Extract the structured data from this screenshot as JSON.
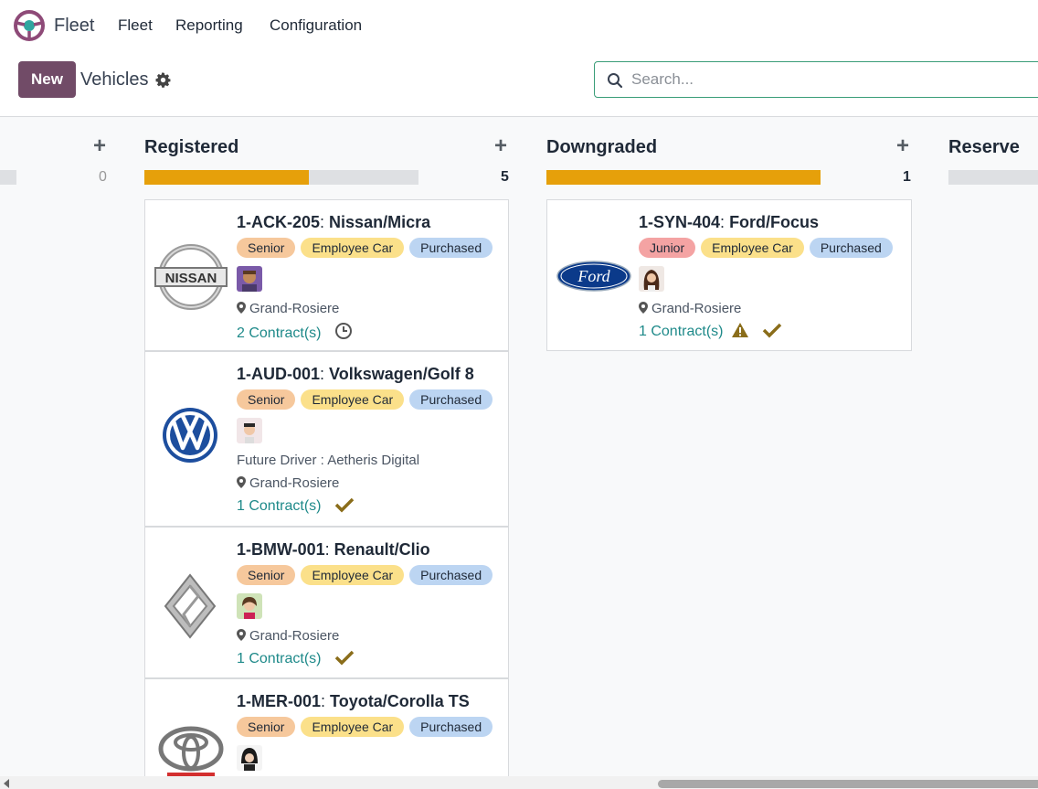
{
  "navbar": {
    "app_name": "Fleet",
    "menus": [
      "Fleet",
      "Reporting",
      "Configuration"
    ]
  },
  "control_panel": {
    "new_label": "New",
    "breadcrumb": "Vehicles",
    "search_placeholder": "Search..."
  },
  "columns": [
    {
      "title": "",
      "count": "0",
      "progress": 0
    },
    {
      "title": "Registered",
      "count": "5",
      "progress": 0.6
    },
    {
      "title": "Downgraded",
      "count": "1",
      "progress": 1.0
    },
    {
      "title": "Reserve",
      "count": "",
      "progress": 0
    }
  ],
  "cards": [
    {
      "plate": "1-ACK-205",
      "model": "Nissan/Micra",
      "tags": [
        "Senior",
        "Employee Car",
        "Purchased"
      ],
      "brand_logo": "nissan-logo",
      "future_driver": "",
      "location": "Grand-Rosiere",
      "contracts": "2 Contract(s)",
      "status_icon": "clock-icon"
    },
    {
      "plate": "1-AUD-001",
      "model": "Volkswagen/Golf 8",
      "tags": [
        "Senior",
        "Employee Car",
        "Purchased"
      ],
      "brand_logo": "volkswagen-logo",
      "future_driver": "Future Driver : Aetheris Digital",
      "location": "Grand-Rosiere",
      "contracts": "1 Contract(s)",
      "status_icon": "check-icon"
    },
    {
      "plate": "1-BMW-001",
      "model": "Renault/Clio",
      "tags": [
        "Senior",
        "Employee Car",
        "Purchased"
      ],
      "brand_logo": "renault-logo",
      "future_driver": "",
      "location": "Grand-Rosiere",
      "contracts": "1 Contract(s)",
      "status_icon": "check-icon"
    },
    {
      "plate": "1-MER-001",
      "model": "Toyota/Corolla TS",
      "tags": [
        "Senior",
        "Employee Car",
        "Purchased"
      ],
      "brand_logo": "toyota-logo",
      "future_driver": "",
      "location": "",
      "contracts": "",
      "status_icon": ""
    },
    {
      "plate": "1-SYN-404",
      "model": "Ford/Focus",
      "tags": [
        "Junior",
        "Employee Car",
        "Purchased"
      ],
      "brand_logo": "ford-logo",
      "future_driver": "",
      "location": "Grand-Rosiere",
      "contracts": "1 Contract(s)",
      "status_icon": "warning-check-icon"
    }
  ],
  "colors": {
    "brand": "#714B67",
    "progress_fill": "#e6a00a",
    "link": "#1f8a8a",
    "check": "#8a6d1a"
  }
}
